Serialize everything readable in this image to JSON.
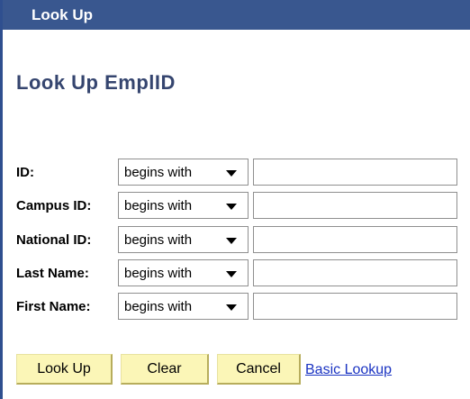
{
  "window": {
    "title": "Look Up"
  },
  "heading": "Look Up EmplID",
  "fields": [
    {
      "label": "ID:",
      "operator": "begins with",
      "value": ""
    },
    {
      "label": "Campus ID:",
      "operator": "begins with",
      "value": ""
    },
    {
      "label": "National ID:",
      "operator": "begins with",
      "value": ""
    },
    {
      "label": "Last Name:",
      "operator": "begins with",
      "value": ""
    },
    {
      "label": "First Name:",
      "operator": "begins with",
      "value": ""
    }
  ],
  "buttons": {
    "lookup": "Look Up",
    "clear": "Clear",
    "cancel": "Cancel"
  },
  "links": {
    "basic_lookup": "Basic Lookup"
  },
  "colors": {
    "titlebar": "#39578f",
    "heading": "#35456f",
    "button_bg": "#fbf6b7",
    "link": "#1a33c2"
  },
  "icons": {
    "dropdown": "chevron-down-icon"
  }
}
